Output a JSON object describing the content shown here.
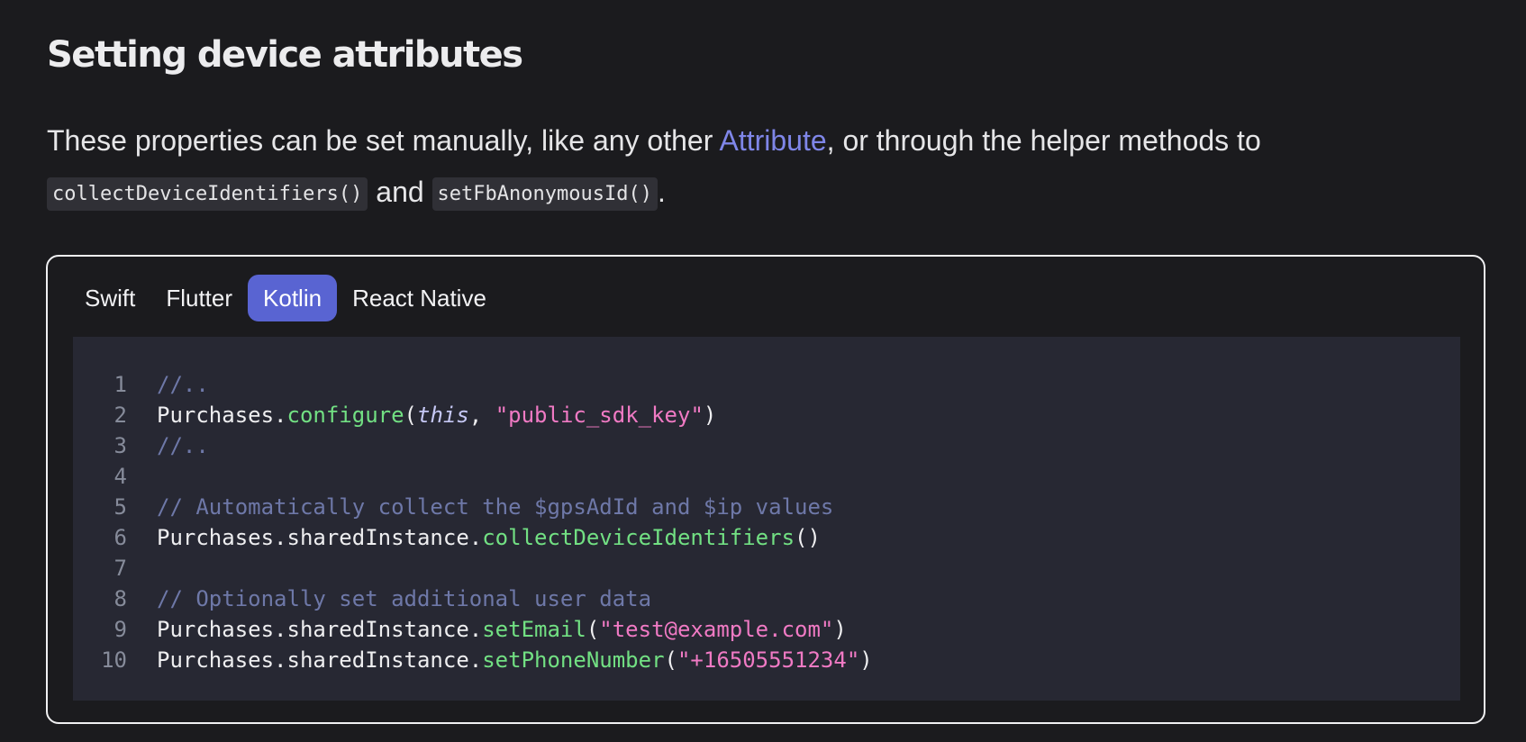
{
  "heading": "Setting device attributes",
  "intro": {
    "text_before": "These properties can be set manually, like any other ",
    "link": "Attribute",
    "text_after": ", or through the helper methods to ",
    "code1": "collectDeviceIdentifiers()",
    "and": " and ",
    "code2": "setFbAnonymousId()",
    "end": "."
  },
  "tabs": [
    {
      "label": "Swift",
      "active": false
    },
    {
      "label": "Flutter",
      "active": false
    },
    {
      "label": "Kotlin",
      "active": true
    },
    {
      "label": "React Native",
      "active": false
    }
  ],
  "code_lines": [
    {
      "n": "1",
      "tokens": [
        {
          "t": "//..",
          "c": "cmt"
        }
      ]
    },
    {
      "n": "2",
      "tokens": [
        {
          "t": "Purchases.",
          "c": "plain"
        },
        {
          "t": "configure",
          "c": "fn"
        },
        {
          "t": "(",
          "c": "plain"
        },
        {
          "t": "this",
          "c": "kw"
        },
        {
          "t": ", ",
          "c": "plain"
        },
        {
          "t": "\"public_sdk_key\"",
          "c": "str"
        },
        {
          "t": ")",
          "c": "plain"
        }
      ]
    },
    {
      "n": "3",
      "tokens": [
        {
          "t": "//..",
          "c": "cmt"
        }
      ]
    },
    {
      "n": "4",
      "tokens": []
    },
    {
      "n": "5",
      "tokens": [
        {
          "t": "// Automatically collect the $gpsAdId and $ip values",
          "c": "cmt"
        }
      ]
    },
    {
      "n": "6",
      "tokens": [
        {
          "t": "Purchases.sharedInstance.",
          "c": "plain"
        },
        {
          "t": "collectDeviceIdentifiers",
          "c": "fn"
        },
        {
          "t": "()",
          "c": "plain"
        }
      ]
    },
    {
      "n": "7",
      "tokens": []
    },
    {
      "n": "8",
      "tokens": [
        {
          "t": "// Optionally set additional user data",
          "c": "cmt"
        }
      ]
    },
    {
      "n": "9",
      "tokens": [
        {
          "t": "Purchases.sharedInstance.",
          "c": "plain"
        },
        {
          "t": "setEmail",
          "c": "fn"
        },
        {
          "t": "(",
          "c": "plain"
        },
        {
          "t": "\"test@example.com\"",
          "c": "str"
        },
        {
          "t": ")",
          "c": "plain"
        }
      ]
    },
    {
      "n": "10",
      "tokens": [
        {
          "t": "Purchases.sharedInstance.",
          "c": "plain"
        },
        {
          "t": "setPhoneNumber",
          "c": "fn"
        },
        {
          "t": "(",
          "c": "plain"
        },
        {
          "t": "\"+16505551234\"",
          "c": "str"
        },
        {
          "t": ")",
          "c": "plain"
        }
      ]
    }
  ],
  "colors": {
    "background": "#1b1b1e",
    "accent": "#5964d2",
    "link": "#7f86e8",
    "code_background": "#272833",
    "code_function": "#72e083",
    "code_string": "#f07ac4",
    "code_comment": "#6e78a8"
  }
}
